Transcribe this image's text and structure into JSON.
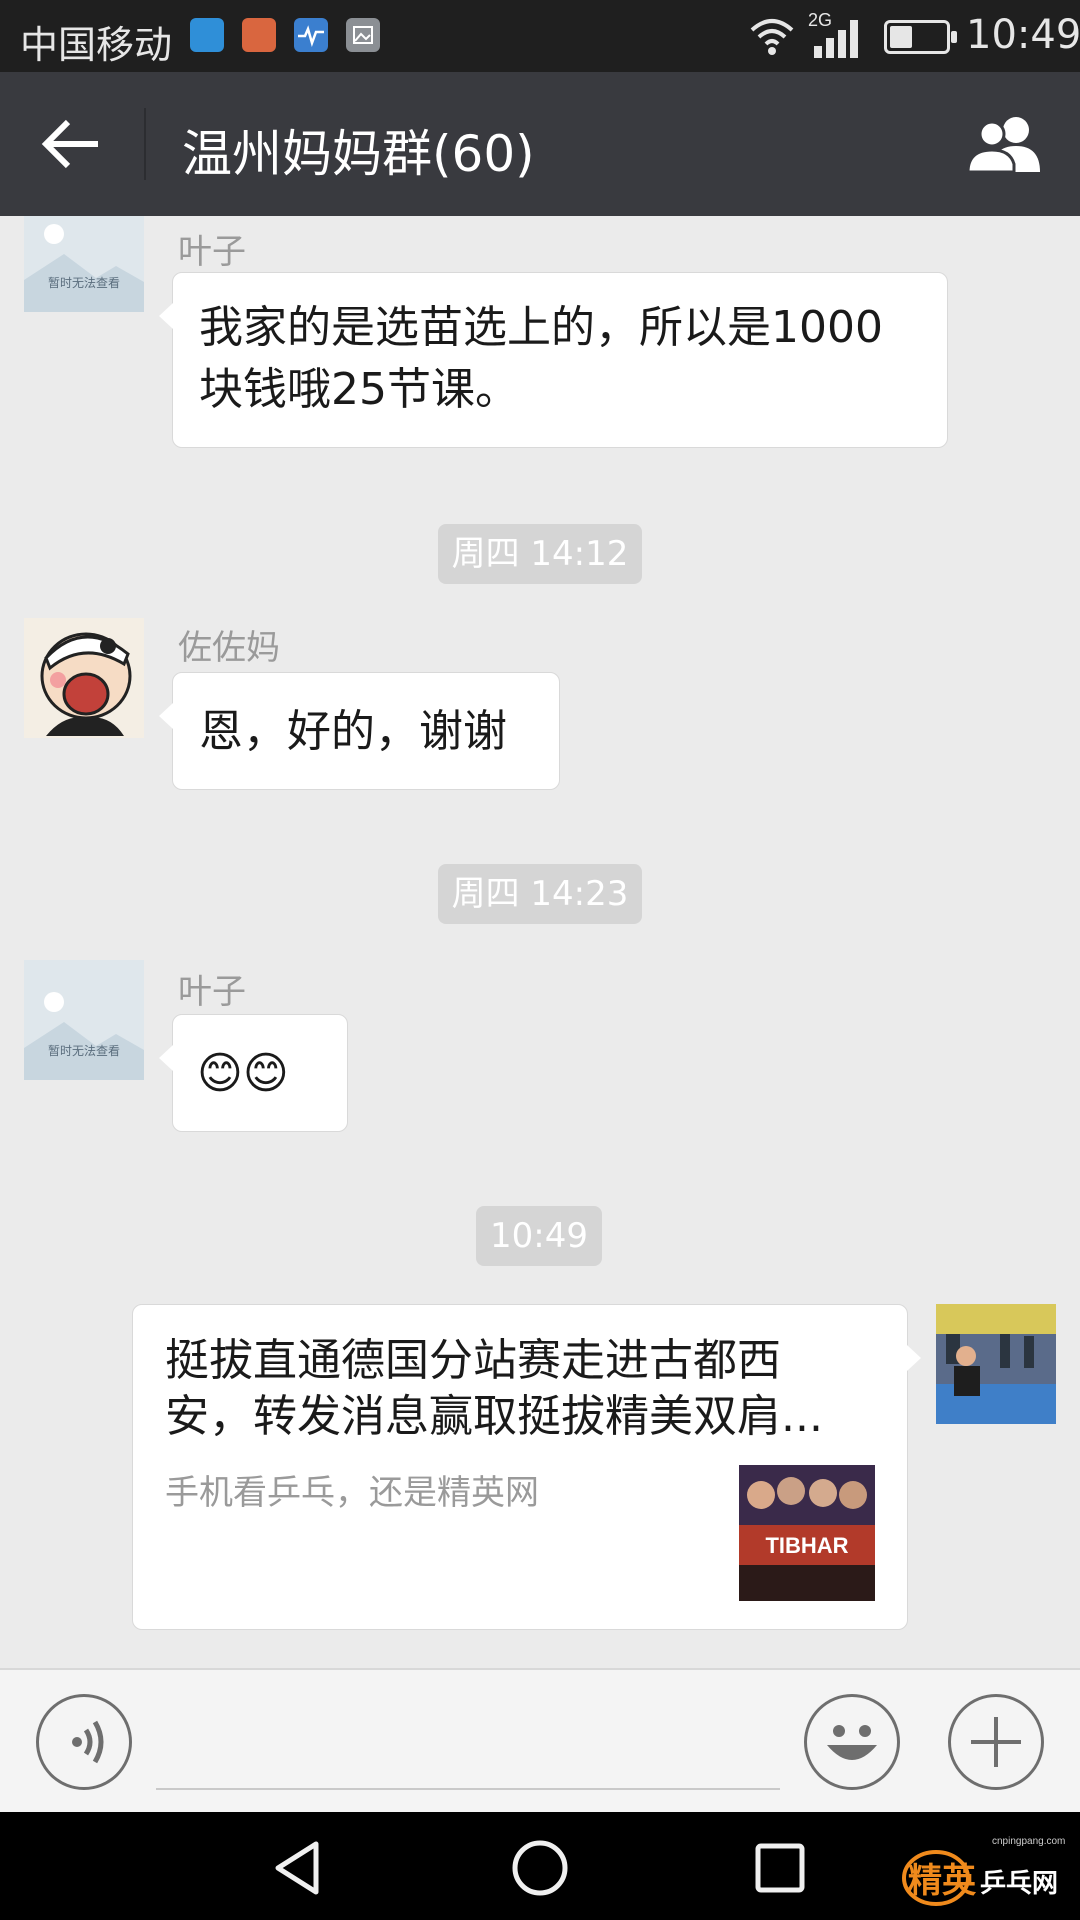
{
  "status_bar": {
    "carrier": "中国移动",
    "network": "2G",
    "time": "10:49",
    "battery_level": 0.4,
    "notification_icons": [
      "app-notification-icon",
      "inbox-icon",
      "health-icon",
      "gallery-icon"
    ]
  },
  "header": {
    "title": "温州妈妈群(60)"
  },
  "avatars": {
    "placeholder_text": "暂时无法查看"
  },
  "messages": [
    {
      "type": "incoming",
      "sender": "叶子",
      "text": "我家的是选苗选上的，所以是1000块钱哦25节课。"
    },
    {
      "type": "time",
      "text": "周四 14:12"
    },
    {
      "type": "incoming",
      "sender": "佐佐妈",
      "text": "恩，好的，谢谢"
    },
    {
      "type": "time",
      "text": "周四 14:23"
    },
    {
      "type": "incoming",
      "sender": "叶子",
      "text": "😊😊"
    },
    {
      "type": "time",
      "text": "10:49"
    },
    {
      "type": "outgoing-link",
      "title": "挺拔直通德国分站赛走进古都西安，转发消息赢取挺拔精美双肩...",
      "description": "手机看乒乓，还是精英网",
      "thumb_text": "TIBHAR"
    }
  ],
  "watermark": {
    "url": "cnpingpang.com",
    "brand": "精英",
    "suffix": "乒乓网"
  },
  "colors": {
    "header_bg": "#393a3f",
    "chat_bg": "#ebebeb",
    "bubble_bg": "#ffffff",
    "time_badge_bg": "#d5d5d5"
  }
}
